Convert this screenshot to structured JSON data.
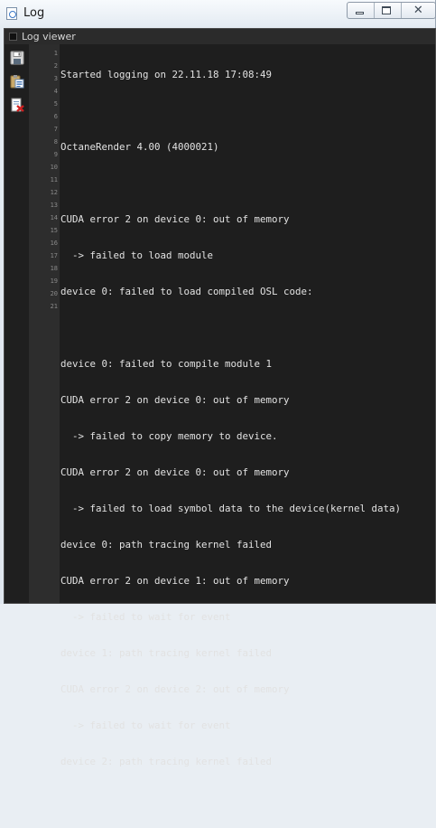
{
  "window": {
    "title": "Log",
    "controls": {
      "minimize": "minimize",
      "maximize": "maximize",
      "close": "✕"
    }
  },
  "panel": {
    "title": "Log viewer"
  },
  "toolbar": {
    "tools": [
      {
        "name": "save-icon"
      },
      {
        "name": "copy-to-clipboard-icon"
      },
      {
        "name": "clear-log-icon"
      }
    ]
  },
  "log": {
    "lines": [
      "Started logging on 22.11.18 17:08:49",
      "",
      "OctaneRender 4.00 (4000021)",
      "",
      "CUDA error 2 on device 0: out of memory",
      "  -> failed to load module",
      "device 0: failed to load compiled OSL code:",
      "",
      "device 0: failed to compile module 1",
      "CUDA error 2 on device 0: out of memory",
      "  -> failed to copy memory to device.",
      "CUDA error 2 on device 0: out of memory",
      "  -> failed to load symbol data to the device(kernel data)",
      "device 0: path tracing kernel failed",
      "CUDA error 2 on device 1: out of memory",
      "  -> failed to wait for event",
      "device 1: path tracing kernel failed",
      "CUDA error 2 on device 2: out of memory",
      "  -> failed to wait for event",
      "device 2: path tracing kernel failed",
      ""
    ]
  }
}
